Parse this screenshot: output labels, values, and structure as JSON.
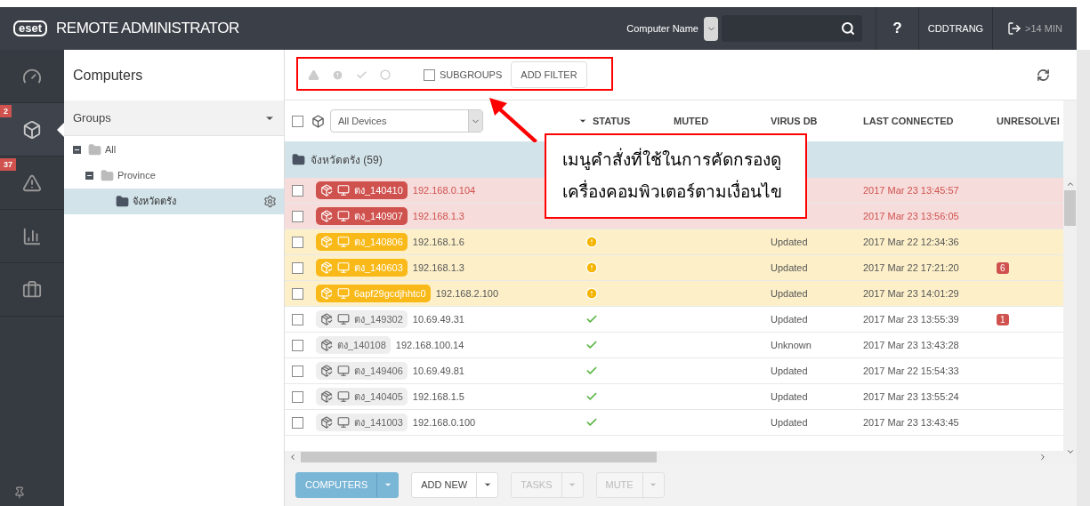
{
  "topbar": {
    "logo": "eset",
    "title": "REMOTE ADMINISTRATOR",
    "search_scope": "Computer Name",
    "help": "?",
    "user": "CDDTRANG",
    "session": ">14 MIN"
  },
  "rail": [
    {
      "kind": "dashboard",
      "selected": false
    },
    {
      "kind": "computers",
      "selected": true,
      "badge": "2"
    },
    {
      "kind": "alerts",
      "selected": false,
      "badge": "37"
    },
    {
      "kind": "reports",
      "selected": false
    },
    {
      "kind": "admin",
      "selected": false
    }
  ],
  "groups_panel": {
    "title": "Computers",
    "header": "Groups",
    "tree": [
      {
        "label": "All",
        "expanded": true,
        "selected": false,
        "children": [
          {
            "label": "Province",
            "expanded": true,
            "selected": false,
            "children": [
              {
                "label": "จังหวัดตรัง",
                "selected": true
              }
            ]
          }
        ]
      }
    ]
  },
  "filter_bar": {
    "subgroups": {
      "label": "SUBGROUPS",
      "checked": false
    },
    "add_filter": "ADD FILTER"
  },
  "table": {
    "select_all": {
      "checked": false
    },
    "device_filter": "All Devices",
    "columns": [
      "STATUS",
      "MUTED",
      "VIRUS DB",
      "LAST CONNECTED",
      "UNRESOLVEI"
    ],
    "group_row": "จังหวัดตรัง (59)",
    "rows": [
      {
        "kind": "error",
        "checked": false,
        "name": "ตง_140410",
        "monitor": true,
        "ip": "192.168.0.104",
        "last_connected": "2017 Mar 23 13:45:57"
      },
      {
        "kind": "error",
        "checked": false,
        "name": "ตง_140907",
        "monitor": true,
        "ip": "192.168.1.3",
        "last_connected": "2017 Mar 23 13:56:05"
      },
      {
        "kind": "warning",
        "checked": false,
        "name": "ตง_140806",
        "monitor": true,
        "ip": "192.168.1.6",
        "status_icon": {
          "kind": "warning"
        },
        "virus_db": "Updated",
        "last_connected": "2017 Mar 22 12:34:36"
      },
      {
        "kind": "warning",
        "checked": false,
        "name": "ตง_140603",
        "monitor": true,
        "ip": "192.168.1.3",
        "status_icon": {
          "kind": "warning"
        },
        "virus_db": "Updated",
        "last_connected": "2017 Mar 22 17:21:20",
        "unresolved": "6"
      },
      {
        "kind": "warning",
        "checked": false,
        "name": "6apf29gcdjhhtc0",
        "monitor": true,
        "ip": "192.168.2.100",
        "status_icon": {
          "kind": "warning"
        },
        "virus_db": "Updated",
        "last_connected": "2017 Mar 23 14:01:29"
      },
      {
        "kind": "ok",
        "checked": false,
        "name": "ตง_149302",
        "monitor": true,
        "ip": "10.69.49.31",
        "status_icon": {
          "kind": "ok"
        },
        "virus_db": "Updated",
        "last_connected": "2017 Mar 23 13:55:39",
        "unresolved": "1"
      },
      {
        "kind": "ok",
        "checked": false,
        "name": "ตง_140108",
        "monitor": false,
        "ip": "192.168.100.14",
        "status_icon": {
          "kind": "ok"
        },
        "virus_db": "Unknown",
        "last_connected": "2017 Mar 23 13:43:28"
      },
      {
        "kind": "ok",
        "checked": false,
        "name": "ตง_149406",
        "monitor": true,
        "ip": "10.69.49.81",
        "status_icon": {
          "kind": "ok"
        },
        "virus_db": "Updated",
        "last_connected": "2017 Mar 22 15:54:33"
      },
      {
        "kind": "ok",
        "checked": false,
        "name": "ตง_140405",
        "monitor": true,
        "ip": "192.168.1.5",
        "status_icon": {
          "kind": "ok"
        },
        "virus_db": "Updated",
        "last_connected": "2017 Mar 23 13:55:24"
      },
      {
        "kind": "ok",
        "checked": false,
        "name": "ตง_141003",
        "monitor": true,
        "ip": "192.168.0.100",
        "status_icon": {
          "kind": "ok"
        },
        "virus_db": "Updated",
        "last_connected": "2017 Mar 23 13:43:45"
      }
    ]
  },
  "bottom_buttons": [
    {
      "label": "COMPUTERS",
      "kind": "primary"
    },
    {
      "label": "ADD NEW",
      "kind": "normal"
    },
    {
      "label": "TASKS",
      "kind": "disabled"
    },
    {
      "label": "MUTE",
      "kind": "disabled"
    }
  ],
  "callout": "เมนูคำสั่งที่ใช้ในการคัดกรองดูเครื่องคอมพิวเตอร์ตามเงื่อนไข"
}
